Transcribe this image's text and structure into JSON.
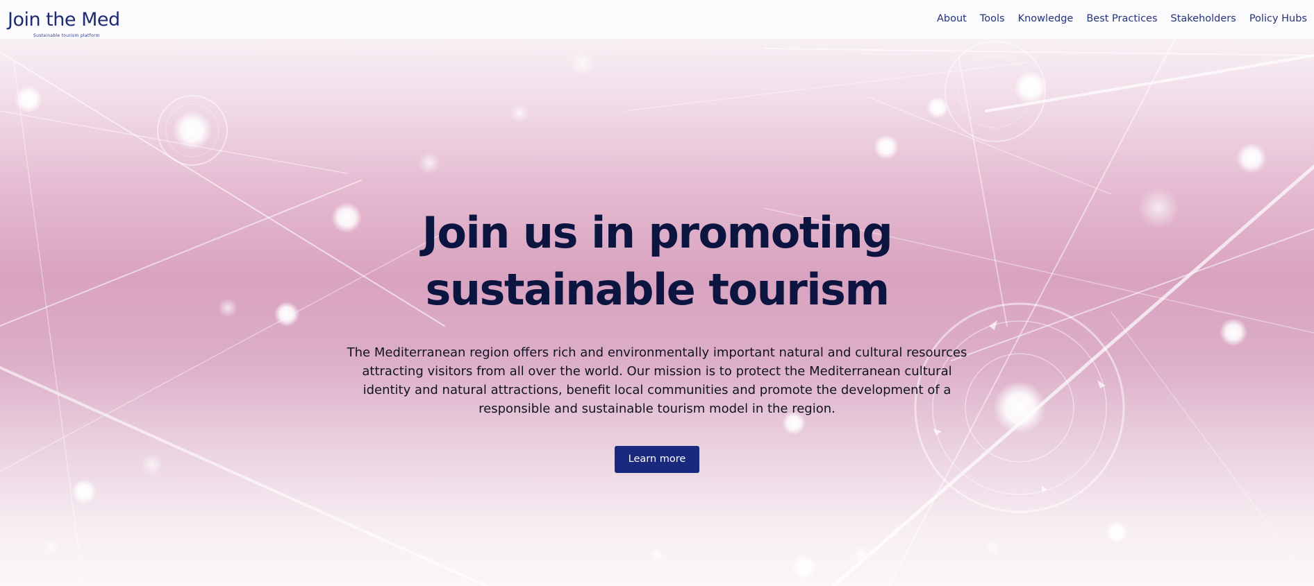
{
  "header": {
    "logo_text": "Join the Med",
    "logo_tagline": "Sustainable tourism platform",
    "nav": [
      {
        "label": "About"
      },
      {
        "label": "Tools"
      },
      {
        "label": "Knowledge"
      },
      {
        "label": "Best Practices"
      },
      {
        "label": "Stakeholders"
      },
      {
        "label": "Policy Hubs"
      }
    ]
  },
  "hero": {
    "title": "Join us in promoting sustainable tourism",
    "description": "The Mediterranean region offers rich and environmentally important natural and cultural resources attracting visitors from all over the world. Our mission is to protect the Mediterranean cultural identity and natural attractions, benefit local communities and promote the development of a responsible and sustainable tourism model in the region.",
    "cta_label": "Learn more"
  },
  "colors": {
    "brand_navy": "#18297e",
    "title_navy": "#0c1440",
    "nav_text": "#24337a",
    "hero_pink": "#d9a3c0"
  },
  "icons": {
    "background": "network-connections-graphic"
  }
}
